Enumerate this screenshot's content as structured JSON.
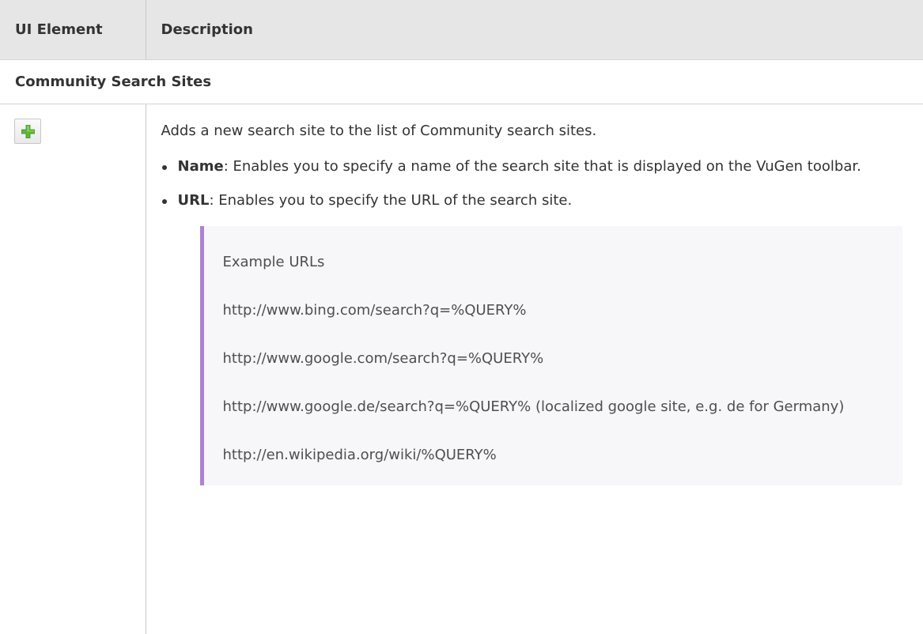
{
  "table": {
    "headers": [
      "UI Element",
      "Description"
    ],
    "section_title": "Community Search Sites"
  },
  "row": {
    "button_icon": "plus-icon",
    "description": "Adds a new search site to the list of Community search sites.",
    "bullets": [
      {
        "term": "Name",
        "text": ": Enables you to specify a name of the search site that is displayed on the VuGen toolbar."
      },
      {
        "term": "URL",
        "text": ": Enables you to specify the URL of the search site."
      }
    ],
    "example": {
      "title": "Example URLs",
      "urls": [
        "http://www.bing.com/search?q=%QUERY%",
        "http://www.google.com/search?q=%QUERY%",
        "http://www.google.de/search?q=%QUERY%  (localized google site, e.g. de for Germany)",
        "http://en.wikipedia.org/wiki/%QUERY%"
      ]
    }
  },
  "colors": {
    "header_bg": "#e6e6e6",
    "note_border": "#ad81d4",
    "plus_green": "#5fb63a"
  }
}
